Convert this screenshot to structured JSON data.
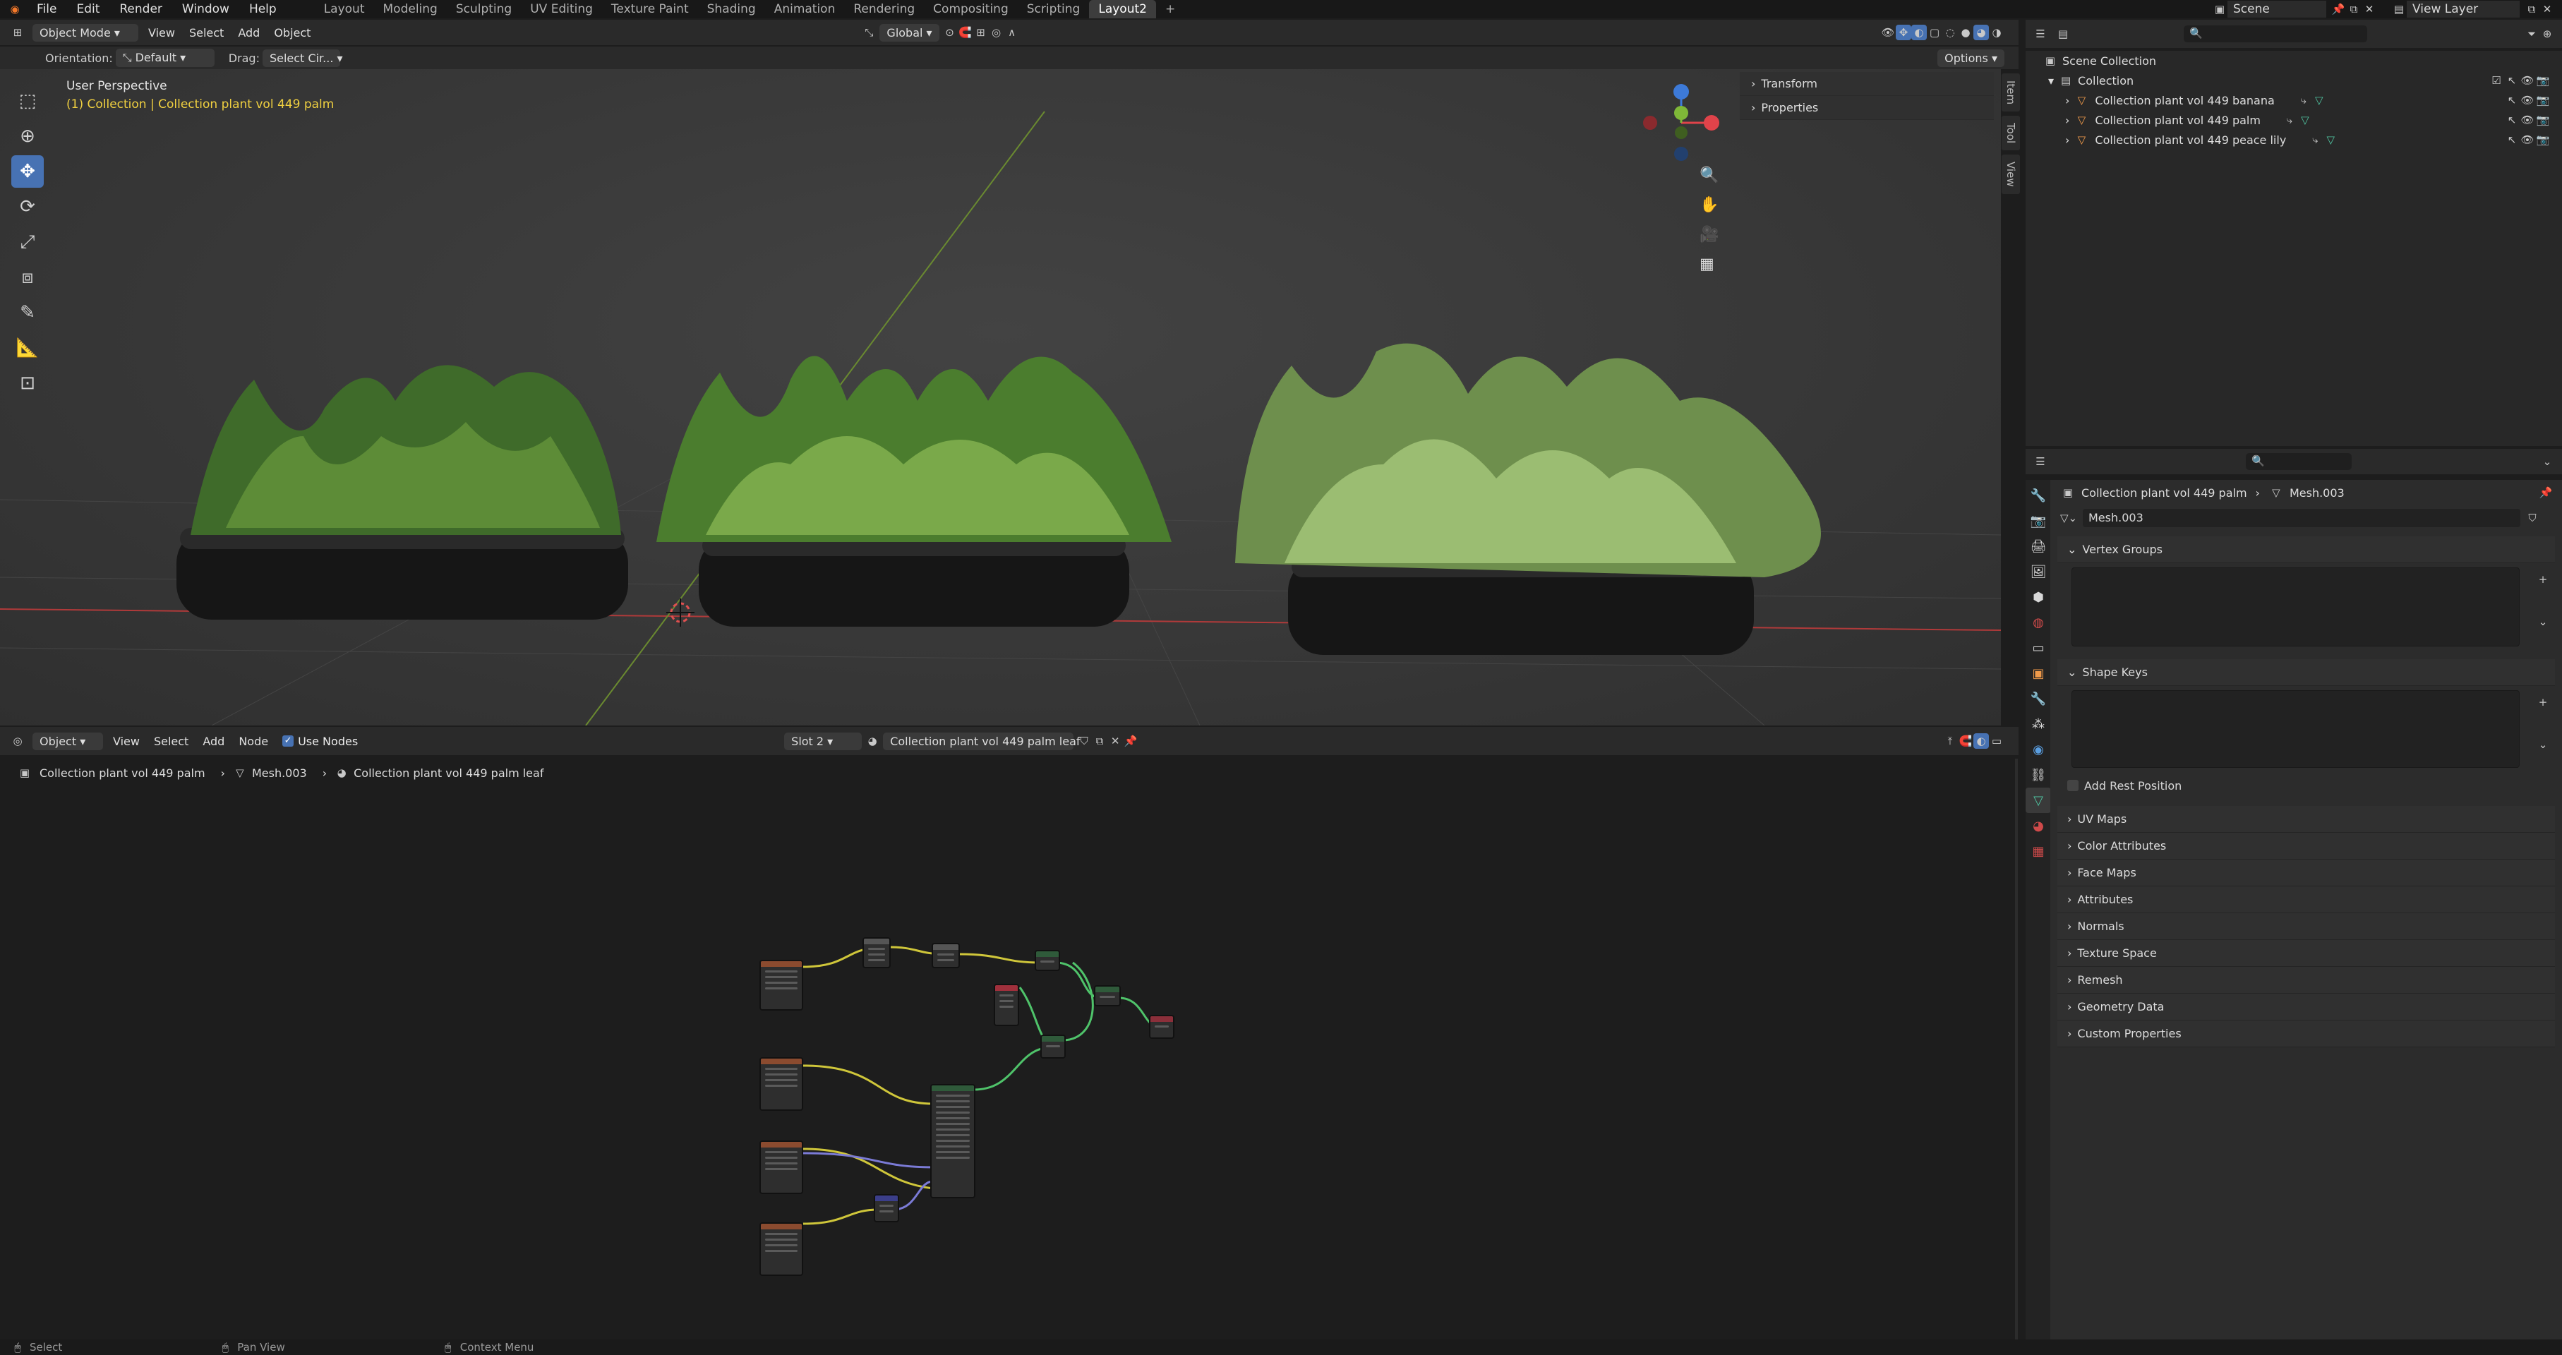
{
  "topbar": {
    "menus": [
      "File",
      "Edit",
      "Render",
      "Window",
      "Help"
    ],
    "workspaces": [
      "Layout",
      "Modeling",
      "Sculpting",
      "UV Editing",
      "Texture Paint",
      "Shading",
      "Animation",
      "Rendering",
      "Compositing",
      "Scripting",
      "Layout2"
    ],
    "add_tab": "+",
    "scene_label": "Scene",
    "view_layer_label": "View Layer"
  },
  "viewport_header": {
    "mode": "Object Mode",
    "menus": [
      "View",
      "Select",
      "Add",
      "Object"
    ],
    "transform_space": "Global",
    "orientation_label": "Orientation:",
    "orientation_value": "Default",
    "drag_label": "Drag:",
    "drag_value": "Select Cir...",
    "options": "Options"
  },
  "viewport": {
    "perspective": "User Perspective",
    "collection_info": "(1) Collection | Collection plant vol 449 palm",
    "npanel": [
      "Transform",
      "Properties"
    ],
    "sidetabs": [
      "Item",
      "Tool",
      "View"
    ],
    "gizmo_labels": {
      "z": "Z",
      "y": "Y",
      "x": "X"
    }
  },
  "node_header": {
    "editor_type": "Object",
    "menus": [
      "View",
      "Select",
      "Add",
      "Node"
    ],
    "use_nodes": "Use Nodes",
    "slot": "Slot 2",
    "material": "Collection plant vol 449 palm leaf",
    "breadcrumb": [
      "Collection plant vol 449 palm",
      "Mesh.003",
      "Collection plant vol 449 palm leaf"
    ]
  },
  "outliner": {
    "root": "Scene Collection",
    "collection": "Collection",
    "items": [
      "Collection plant vol 449 banana",
      "Collection plant vol 449 palm",
      "Collection plant vol 449 peace lily"
    ]
  },
  "properties": {
    "breadcrumb_object": "Collection plant vol 449 palm",
    "breadcrumb_mesh": "Mesh.003",
    "mesh_name": "Mesh.003",
    "vertex_groups": "Vertex Groups",
    "shape_keys": "Shape Keys",
    "add_rest_position": "Add Rest Position",
    "sections": [
      "UV Maps",
      "Color Attributes",
      "Face Maps",
      "Attributes",
      "Normals",
      "Texture Space",
      "Remesh",
      "Geometry Data",
      "Custom Properties"
    ]
  },
  "statusbar": {
    "items": [
      "Select",
      "Pan View",
      "Context Menu"
    ]
  },
  "colors": {
    "accent": "#4772b3",
    "x_axis": "#e0434a",
    "y_axis": "#7fb838",
    "z_axis": "#3d7ad8",
    "collection_text": "#f0d040",
    "node_link_yellow": "#cfc63a",
    "node_link_green": "#4fc36a"
  }
}
